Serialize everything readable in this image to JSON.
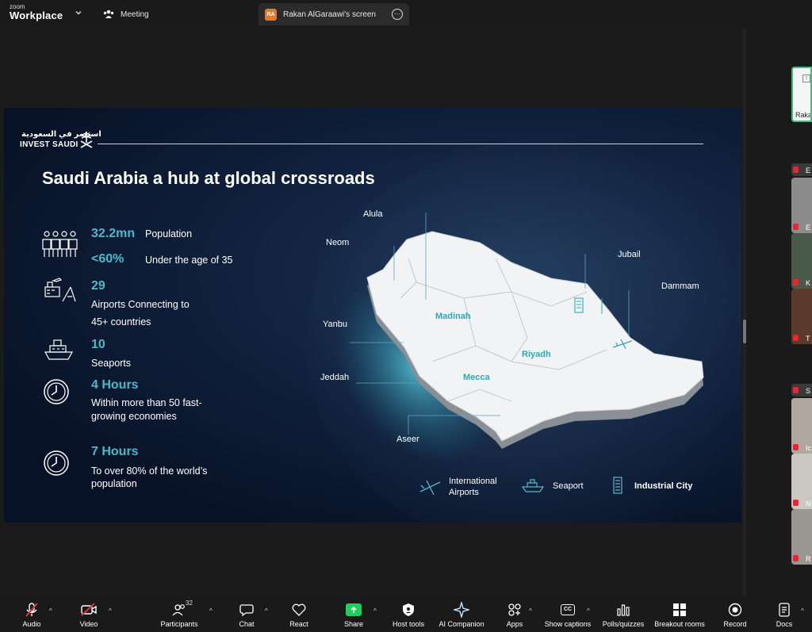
{
  "app": {
    "brand_small": "zoom",
    "brand_big": "Workplace",
    "tab_meeting": "Meeting",
    "tab_screen_initials": "RA",
    "tab_screen_label": "Rakan AlGaraawi's screen"
  },
  "slide": {
    "logo_arabic": "استثمر في السعودية",
    "logo_english": "INVEST SAUDI",
    "title": "Saudi Arabia a hub at global crossroads",
    "stats": {
      "population_value": "32.2mn",
      "population_label": "Population",
      "youth_value": "<60%",
      "youth_label": "Under the age of 35",
      "airports_value": "29",
      "airports_label_1": "Airports Connecting to",
      "airports_label_2": "45+ countries",
      "seaports_value": "10",
      "seaports_label": "Seaports",
      "hours4_value": "4 Hours",
      "hours4_label_1": "Within more than 50 fast-",
      "hours4_label_2": "growing economies",
      "hours7_value": "7 Hours",
      "hours7_label_1": "To over  80% of the world’s",
      "hours7_label_2": "population"
    },
    "map": {
      "cities": {
        "alula": "Alula",
        "neom": "Neom",
        "jubail": "Jubail",
        "dammam": "Dammam",
        "yanbu": "Yanbu",
        "jeddah": "Jeddah",
        "aseer": "Aseer"
      },
      "regions": {
        "madinah": "Madinah",
        "riyadh": "Riyadh",
        "mecca": "Mecca"
      }
    },
    "legend": {
      "airports_1": "International",
      "airports_2": "Airports",
      "seaport": "Seaport",
      "industrial": "Industrial City"
    }
  },
  "participants": {
    "active_name": "Raka",
    "tiles": [
      "E",
      "E",
      "K",
      "T",
      "S",
      "Ic",
      "N",
      "R"
    ]
  },
  "toolbar": {
    "audio": "Audio",
    "video": "Video",
    "participants": "Participants",
    "participants_count": "32",
    "chat": "Chat",
    "react": "React",
    "share": "Share",
    "host_tools": "Host tools",
    "ai_companion": "AI Companion",
    "apps": "Apps",
    "show_captions": "Show captions",
    "polls": "Polls/quizzes",
    "breakout": "Breakout rooms",
    "record": "Record",
    "docs": "Docs"
  },
  "colors": {
    "accent_teal": "#4bb9c9",
    "share_green": "#1bd15a",
    "mute_red": "#e23333",
    "slide_bg": "#0f1f3a"
  }
}
